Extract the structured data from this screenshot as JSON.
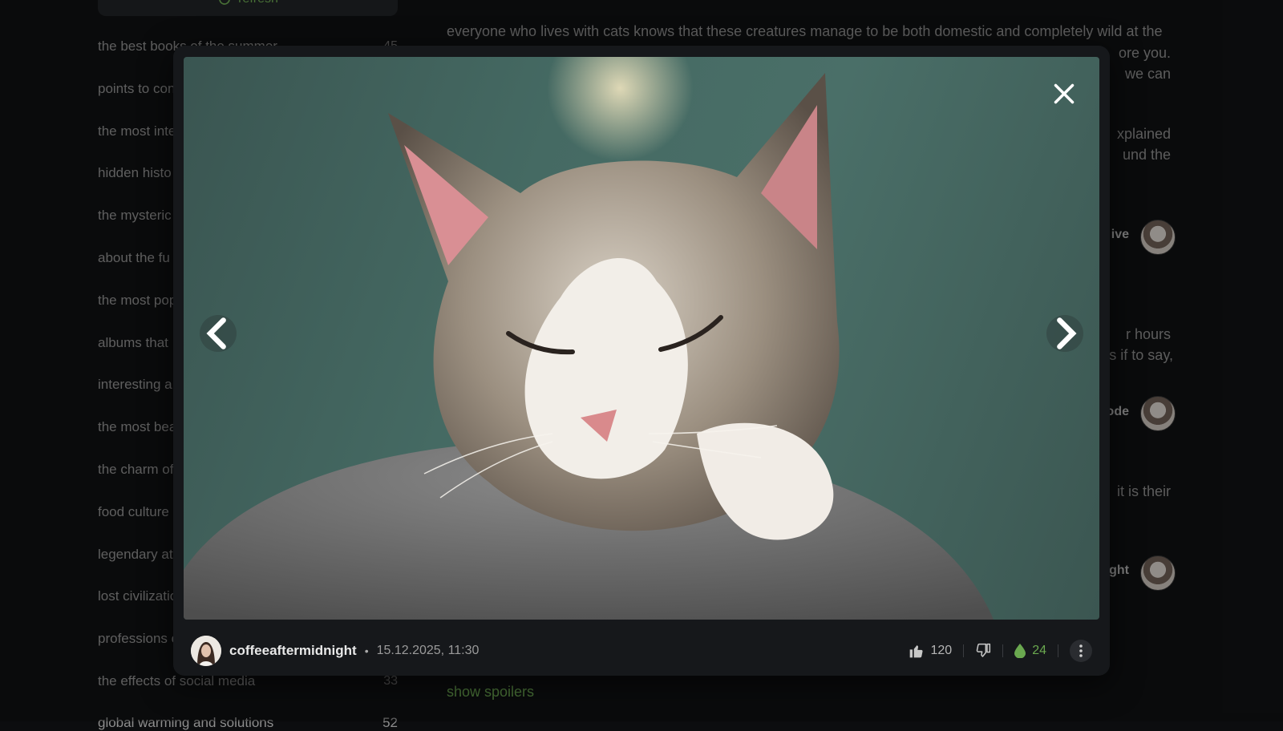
{
  "background": {
    "refresh_label": "refresh",
    "topics": [
      {
        "label": "the best books of the summer",
        "count": "45"
      },
      {
        "label": "points to con",
        "count": ""
      },
      {
        "label": "the most inte",
        "count": ""
      },
      {
        "label": "hidden histo",
        "count": ""
      },
      {
        "label": "the mysteric",
        "count": ""
      },
      {
        "label": "about the fu",
        "count": ""
      },
      {
        "label": "the most pop",
        "count": ""
      },
      {
        "label": "albums that",
        "count": ""
      },
      {
        "label": "interesting a",
        "count": ""
      },
      {
        "label": "the most bea",
        "count": ""
      },
      {
        "label": "the charm of",
        "count": ""
      },
      {
        "label": "food culture",
        "count": ""
      },
      {
        "label": "legendary at",
        "count": ""
      },
      {
        "label": "lost civilizatio",
        "count": ""
      },
      {
        "label": "professions c",
        "count": ""
      },
      {
        "label": "the effects of social media",
        "count": "33"
      }
    ],
    "bottom_topic": {
      "label": "global warming and solutions",
      "count": "52"
    },
    "article_text": "everyone who lives with cats knows that these creatures manage to be both domestic and completely wild at the",
    "right_fragments": [
      {
        "text": "ore you.",
        "bold": false
      },
      {
        "text": "we can",
        "bold": false
      },
      {
        "text": "xplained",
        "bold": false
      },
      {
        "text": "und the",
        "bold": false
      },
      {
        "text": "ive",
        "bold": true
      },
      {
        "text": "r hours",
        "bold": false
      },
      {
        "text": "s if to say,",
        "bold": false
      },
      {
        "text": "ode",
        "bold": true
      },
      {
        "text": "it is their",
        "bold": false
      },
      {
        "text": "ght",
        "bold": true
      }
    ],
    "show_spoilers": "show spoilers"
  },
  "modal": {
    "author": "coffeeaftermidnight",
    "separator": "•",
    "date": "15.12.2025, 11:30",
    "likes": "120",
    "drops": "24",
    "photo_subject": "sleeping tabby and white cat on grey cat tree",
    "icons": {
      "close": "close-icon",
      "prev": "chevron-left-icon",
      "next": "chevron-right-icon",
      "like": "thumbs-up-icon",
      "dislike": "thumbs-down-icon",
      "drop": "drop-icon",
      "more": "more-vertical-icon"
    }
  },
  "colors": {
    "accent_green": "#6aa84f",
    "background": "#0c0d0f",
    "modal_bg": "#16181b"
  }
}
